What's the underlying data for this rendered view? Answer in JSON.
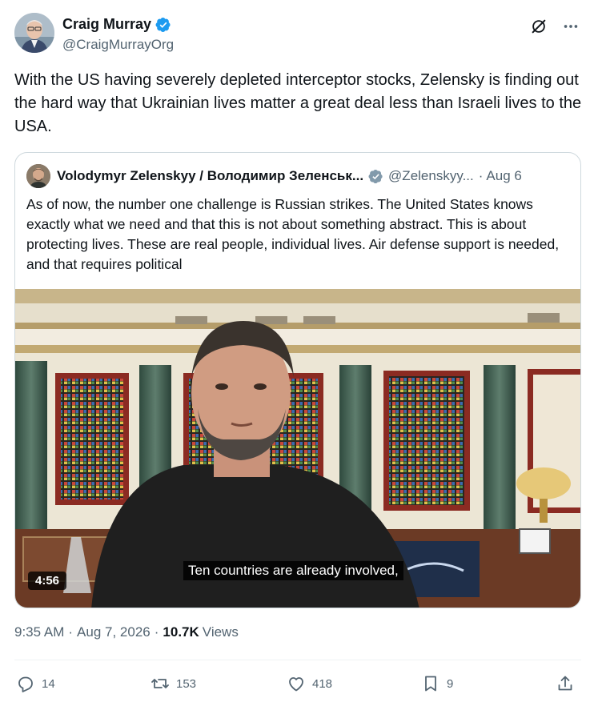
{
  "author": {
    "name": "Craig Murray",
    "handle": "@CraigMurrayOrg"
  },
  "tweet": {
    "text": "With the US having severely depleted interceptor stocks, Zelensky is finding out the hard way that Ukrainian lives matter a great deal less than Israeli lives to the USA."
  },
  "quoted": {
    "name": "Volodymyr Zelenskyy / Володимир Зеленськ...",
    "handle": "@Zelenskyy...",
    "date": "Aug 6",
    "text": "As of now, the number one challenge is Russian strikes. The United States knows exactly what we need and that this is not about something abstract. This is about protecting lives. These are real people, individual lives. Air defense support is needed, and that requires political",
    "video": {
      "duration": "4:56",
      "subtitle": "Ten countries are already involved,"
    }
  },
  "meta": {
    "time": "9:35 AM",
    "date": "Aug 7, 2026",
    "views_count": "10.7K",
    "views_label": "Views"
  },
  "actions": {
    "replies": "14",
    "reposts": "153",
    "likes": "418",
    "bookmarks": "9"
  },
  "colors": {
    "verified_blue": "#1d9bf0",
    "text_primary": "#0f1419",
    "text_secondary": "#536471",
    "border": "#cfd9de"
  }
}
